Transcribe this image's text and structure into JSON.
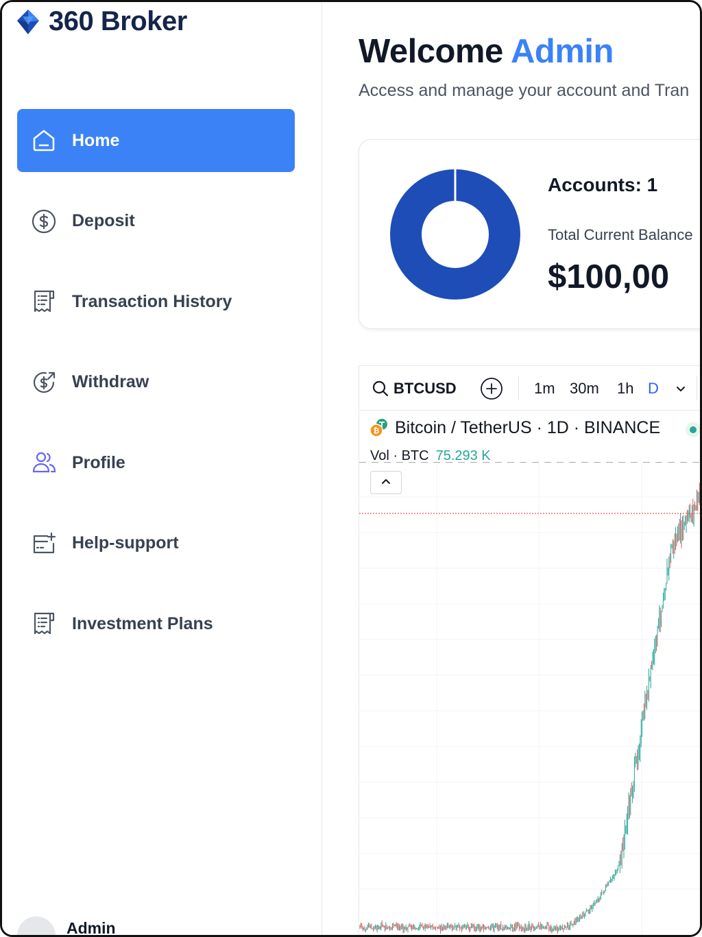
{
  "brand": {
    "name": "360 Broker",
    "logo_icon": "diamond-logo-icon"
  },
  "sidebar": {
    "items": [
      {
        "label": "Home",
        "icon": "home-icon",
        "active": true
      },
      {
        "label": "Deposit",
        "icon": "dollar-circle-icon",
        "active": false
      },
      {
        "label": "Transaction History",
        "icon": "receipt-icon",
        "active": false
      },
      {
        "label": "Withdraw",
        "icon": "dollar-arrow-icon",
        "active": false
      },
      {
        "label": "Profile",
        "icon": "users-icon",
        "active": false
      },
      {
        "label": "Help-support",
        "icon": "ticket-icon",
        "active": false
      },
      {
        "label": "Investment Plans",
        "icon": "receipt-icon",
        "active": false
      }
    ],
    "user": {
      "name": "Admin"
    }
  },
  "header": {
    "welcome": "Welcome",
    "user": "Admin",
    "subtitle": "Access and manage your account and Tran"
  },
  "summary": {
    "accounts_label": "Accounts: 1",
    "balance_label": "Total Current Balance",
    "balance_value": "$100,00"
  },
  "chart_widget": {
    "symbol": "BTCUSD",
    "intervals": [
      "1m",
      "30m",
      "1h",
      "D"
    ],
    "active_interval": "D",
    "title": "Bitcoin / TetherUS · 1D · BINANCE",
    "volume_label": "Vol · BTC",
    "volume_value": "75.293 K"
  },
  "colors": {
    "accent": "#3b82f6",
    "brand_dark": "#14254a",
    "donut": "#1e4db7",
    "candle_up": "#26a69a",
    "candle_down": "#ef5350"
  }
}
